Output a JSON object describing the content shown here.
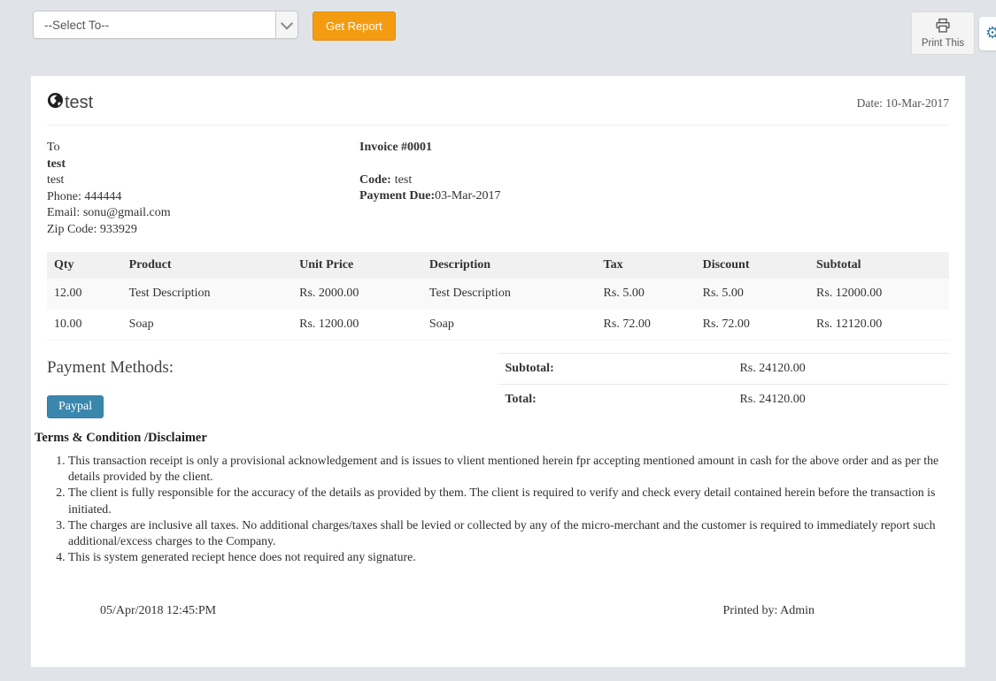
{
  "toolbar": {
    "select_value": "--Select To--",
    "get_report_label": "Get Report",
    "print_label": "Print This"
  },
  "invoice": {
    "title": "test",
    "date": "Date: 10-Mar-2017",
    "to": {
      "label": "To",
      "name": "test",
      "line2": "test",
      "phone": "Phone: 444444",
      "email": "Email: sonu@gmail.com",
      "zip": "Zip Code: 933929"
    },
    "details": {
      "invoice_no": "Invoice #0001",
      "code_label": "Code:",
      "code_value": "test",
      "payment_due_label": "Payment Due:",
      "payment_due_value": "03-Mar-2017"
    },
    "table": {
      "headers": [
        "Qty",
        "Product",
        "Unit Price",
        "Description",
        "Tax",
        "Discount",
        "Subtotal"
      ],
      "rows": [
        [
          "12.00",
          "Test Description",
          "Rs. 2000.00",
          "Test Description",
          "Rs. 5.00",
          "Rs. 5.00",
          "Rs. 12000.00"
        ],
        [
          "10.00",
          "Soap",
          "Rs. 1200.00",
          "Soap",
          "Rs. 72.00",
          "Rs. 72.00",
          "Rs. 12120.00"
        ]
      ]
    },
    "payment": {
      "heading": "Payment Methods:",
      "paypal_label": "Paypal"
    },
    "totals": {
      "subtotal_label": "Subtotal:",
      "subtotal_value": "Rs. 24120.00",
      "total_label": "Total:",
      "total_value": "Rs. 24120.00"
    },
    "terms": {
      "title": "Terms & Condition /Disclaimer",
      "items": [
        "This transaction receipt is only a provisional acknowledgement and is issues to vlient mentioned herein fpr accepting mentioned amount in cash for the above order and as per the details provided by the client.",
        "The client is fully responsible for the accuracy of the details as provided by them. The client is required to verify and check every detail contained herein before the transaction is initiated.",
        "The charges are inclusive all taxes. No additional charges/taxes shall be levied or collected by any of the micro-merchant and the customer is required to immediately report such additional/excess charges to the Company.",
        "This is system generated reciept hence does not required any signature."
      ]
    },
    "footer": {
      "datetime": "05/Apr/2018 12:45:PM",
      "printed_by": "Printed by: Admin"
    }
  },
  "colors": {
    "page_bg": "#e0e4e8",
    "accent_orange": "#f39c12",
    "paypal_blue": "#3a87ad",
    "gear_blue": "#367fa9"
  }
}
